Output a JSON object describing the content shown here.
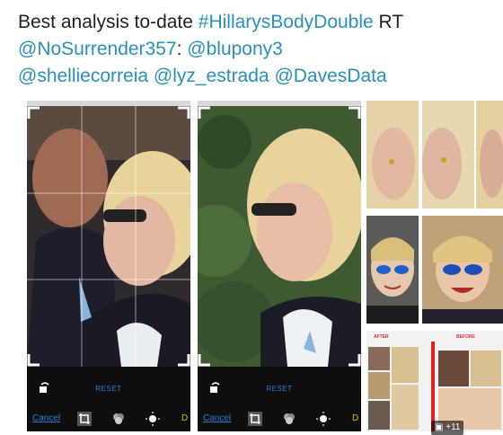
{
  "tweet": {
    "text_prefix": "Best analysis to-date ",
    "hashtag": "#HillarysBodyDouble",
    "rt": " RT",
    "mention_main": "@NoSurrender357",
    "colon": ":",
    "mentions": [
      "@blupony3",
      "@shelliecorreia",
      "@lyz_estrada",
      "@DavesData"
    ]
  },
  "editor": {
    "reset_label": "RESET",
    "cancel_label": "Cancel",
    "done_label": "D"
  },
  "comparison": {
    "left_label": "AFTER",
    "right_label": "BEFORE"
  },
  "media_badge": {
    "count_label": "+11"
  },
  "colors": {
    "link": "#2b8fb9",
    "ios_blue": "#2b7cd3",
    "comparison_divider": "#e02020"
  }
}
